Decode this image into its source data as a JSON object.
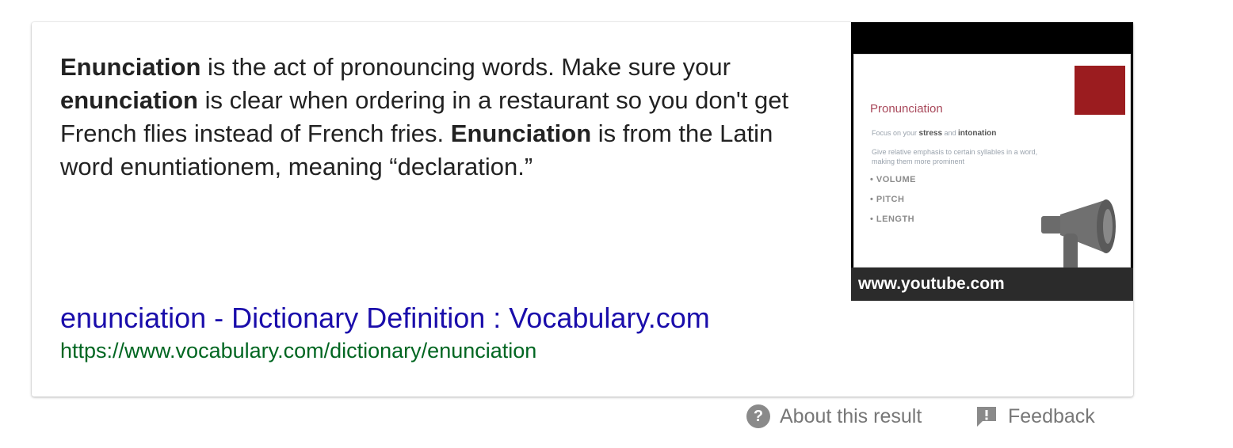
{
  "snippet": {
    "parts": [
      {
        "text": "Enunciation",
        "bold": true
      },
      {
        "text": " is the act of pronouncing words. Make sure your ",
        "bold": false
      },
      {
        "text": "enunciation",
        "bold": true
      },
      {
        "text": " is clear when ordering in a restaurant so you don't get French flies instead of French fries. ",
        "bold": false
      },
      {
        "text": "Enunciation",
        "bold": true
      },
      {
        "text": " is from the Latin word enuntiationem, meaning “declaration.”",
        "bold": false
      }
    ]
  },
  "result": {
    "title": "enunciation - Dictionary Definition : Vocabulary.com",
    "url": "https://www.vocabulary.com/dictionary/enunciation"
  },
  "thumbnail": {
    "caption": "www.youtube.com",
    "slide_title": "Pronunciation",
    "slide_line1_pre": "Focus on your ",
    "slide_line1_b1": "stress",
    "slide_line1_mid": " and ",
    "slide_line1_b2": "intonation",
    "slide_line2": "Give relative emphasis to certain syllables in a word,",
    "slide_line3": "making them more prominent",
    "slide_items": [
      "• VOLUME",
      "• PITCH",
      "• LENGTH"
    ]
  },
  "footer": {
    "about_label": "About this result",
    "feedback_label": "Feedback"
  },
  "colors": {
    "title_link": "#1a0dab",
    "url_green": "#006621",
    "text": "#222222",
    "footer_gray": "#777777",
    "slide_red": "#9b1c1f"
  },
  "icons": {
    "about": "help-circle-icon",
    "feedback": "feedback-icon",
    "slide": "megaphone-icon"
  }
}
